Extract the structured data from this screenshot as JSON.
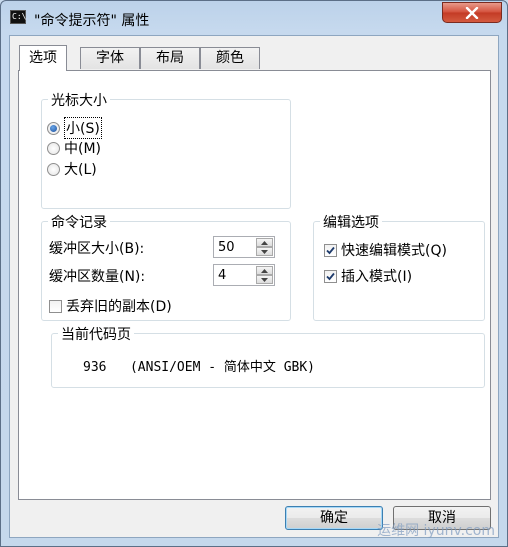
{
  "window": {
    "title": "\"命令提示符\" 属性",
    "app_icon_text": "C:\\",
    "close_icon": "close-x-icon"
  },
  "tabs": [
    {
      "label": "选项",
      "active": true
    },
    {
      "label": "字体",
      "active": false
    },
    {
      "label": "布局",
      "active": false
    },
    {
      "label": "颜色",
      "active": false
    }
  ],
  "cursor_size": {
    "legend": "光标大小",
    "options": [
      {
        "label": "小(S)",
        "checked": true
      },
      {
        "label": "中(M)",
        "checked": false
      },
      {
        "label": "大(L)",
        "checked": false
      }
    ]
  },
  "command_history": {
    "legend": "命令记录",
    "buffer_size_label": "缓冲区大小(B):",
    "buffer_size_value": "50",
    "buffer_count_label": "缓冲区数量(N):",
    "buffer_count_value": "4",
    "discard_old_label": "丢弃旧的副本(D)",
    "discard_old_checked": false
  },
  "edit_options": {
    "legend": "编辑选项",
    "quick_edit_label": "快速编辑模式(Q)",
    "quick_edit_checked": true,
    "insert_mode_label": "插入模式(I)",
    "insert_mode_checked": true
  },
  "code_page": {
    "legend": "当前代码页",
    "value": "936   (ANSI/OEM - 简体中文 GBK)"
  },
  "buttons": {
    "ok": "确定",
    "cancel": "取消"
  },
  "watermark": "运维网 iyunv.com"
}
